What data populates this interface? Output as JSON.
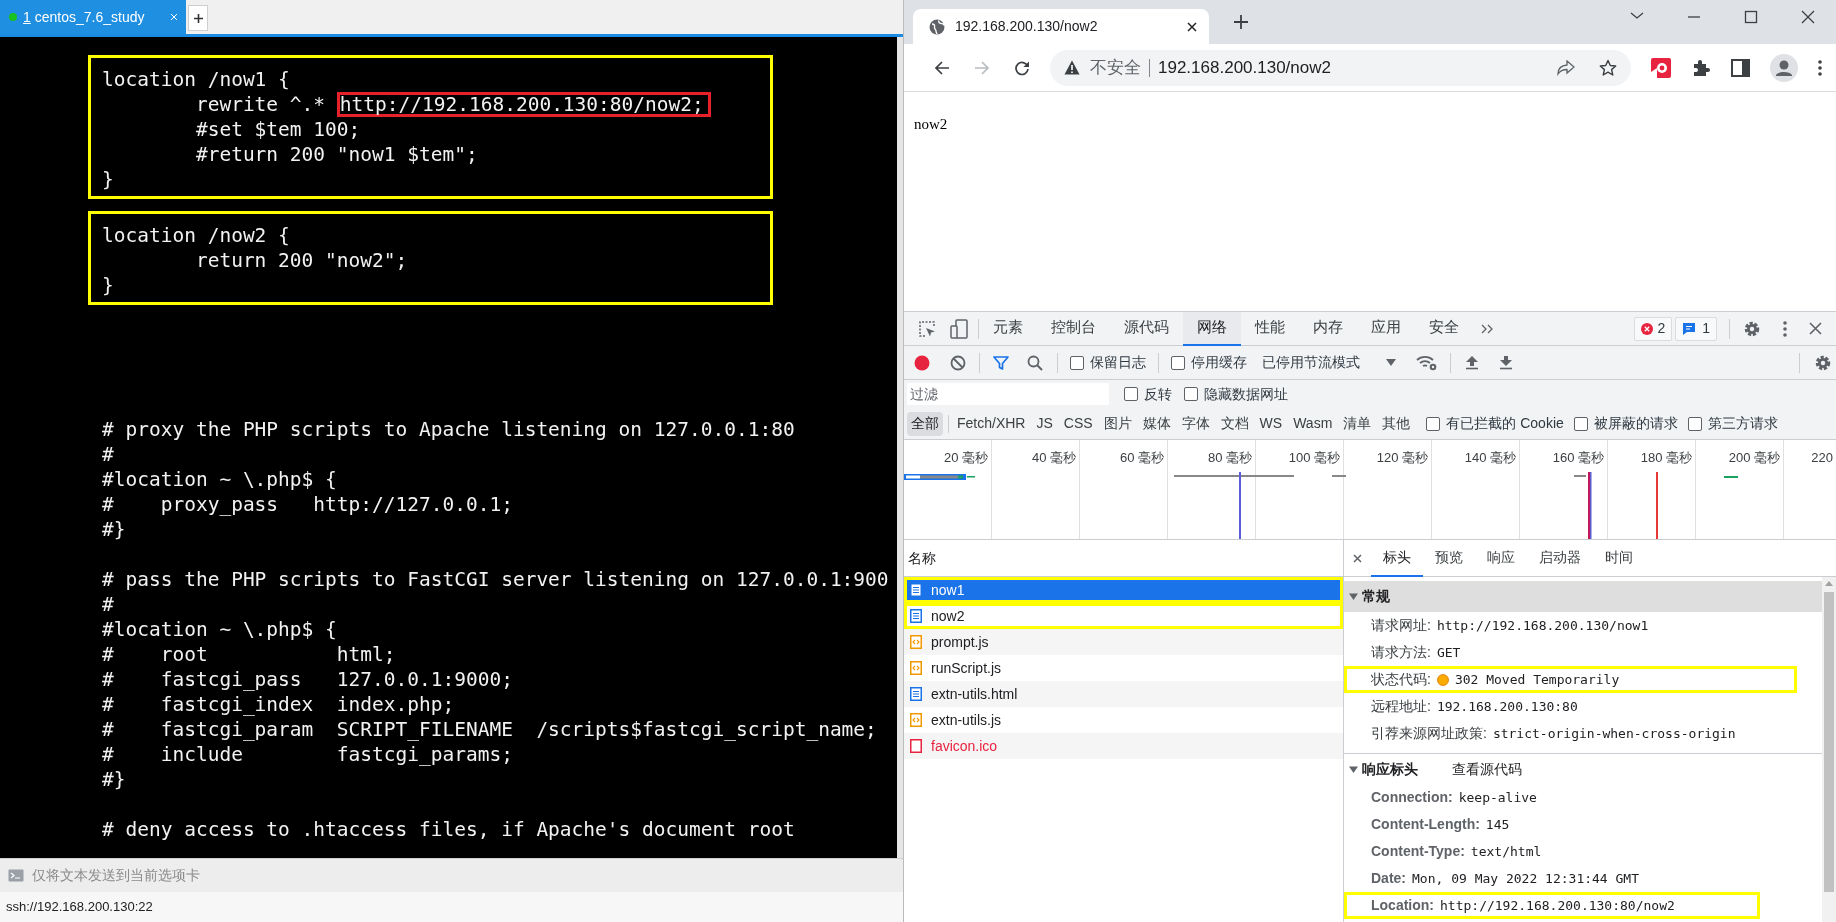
{
  "terminal": {
    "tabs": [
      {
        "number": "1",
        "label": "centos_7.6_study",
        "selected": true,
        "connected": true
      }
    ],
    "blocks": [
      {
        "annotated": true,
        "lines": [
          {
            "text": "location /now1 {"
          },
          {
            "text": "        rewrite ^.* ",
            "marked": "http://192.168.200.130:80/now2;"
          },
          {
            "text": "        #set $tem 100;"
          },
          {
            "text": "        #return 200 \"now1 $tem\";"
          },
          {
            "text": "}"
          }
        ]
      },
      {
        "annotated": true,
        "lines": [
          {
            "text": "location /now2 {"
          },
          {
            "text": "        return 200 \"now2\";"
          },
          {
            "text": "}"
          }
        ]
      },
      {
        "annotated": false,
        "lines": [
          {
            "text": "# proxy the PHP scripts to Apache listening on 127.0.0.1:80"
          },
          {
            "text": "#"
          },
          {
            "text": "#location ~ \\.php$ {"
          },
          {
            "text": "#    proxy_pass   http://127.0.0.1;"
          },
          {
            "text": "#}"
          }
        ]
      },
      {
        "annotated": false,
        "lines": [
          {
            "text": "# pass the PHP scripts to FastCGI server listening on 127.0.0.1:900"
          },
          {
            "text": "#"
          },
          {
            "text": "#location ~ \\.php$ {"
          },
          {
            "text": "#    root           html;"
          },
          {
            "text": "#    fastcgi_pass   127.0.0.1:9000;"
          },
          {
            "text": "#    fastcgi_index  index.php;"
          },
          {
            "text": "#    fastcgi_param  SCRIPT_FILENAME  /scripts$fastcgi_script_name;"
          },
          {
            "text": "#    include        fastcgi_params;"
          },
          {
            "text": "#}"
          }
        ]
      },
      {
        "annotated": false,
        "lines": [
          {
            "text": "# deny access to .htaccess files, if Apache's document root"
          }
        ]
      }
    ],
    "send_bar": {
      "placeholder": "仅将文本发送到当前选项卡"
    },
    "status": "ssh://192.168.200.130:22"
  },
  "browser": {
    "tabs": [
      {
        "title": "192.168.200.130/now2",
        "selected": true
      }
    ],
    "navigation": {
      "back_enabled": true,
      "forward_enabled": false
    },
    "address": {
      "security_label": "不安全",
      "url": "192.168.200.130/now2"
    },
    "page": {
      "text": "now2"
    },
    "devtools": {
      "tabs": [
        {
          "label": "元素",
          "selected": false
        },
        {
          "label": "控制台",
          "selected": false
        },
        {
          "label": "源代码",
          "selected": false
        },
        {
          "label": "网络",
          "selected": true
        },
        {
          "label": "性能",
          "selected": false
        },
        {
          "label": "内存",
          "selected": false
        },
        {
          "label": "应用",
          "selected": false
        },
        {
          "label": "安全",
          "selected": false
        }
      ],
      "errors": "2",
      "messages": "1",
      "recording": true,
      "filter_enabled": true,
      "preserve_log": {
        "label": "保留日志",
        "checked": false
      },
      "disable_cache": {
        "label": "停用缓存",
        "checked": false
      },
      "throttling": "已停用节流模式",
      "filter": {
        "placeholder": "过滤"
      },
      "filter_checks": [
        {
          "label": "反转",
          "checked": false
        },
        {
          "label": "隐藏数据网址",
          "checked": false
        }
      ],
      "type_filters": [
        {
          "label": "全部",
          "selected": true
        },
        {
          "label": "Fetch/XHR",
          "selected": false
        },
        {
          "label": "JS",
          "selected": false
        },
        {
          "label": "CSS",
          "selected": false
        },
        {
          "label": "图片",
          "selected": false
        },
        {
          "label": "媒体",
          "selected": false
        },
        {
          "label": "字体",
          "selected": false
        },
        {
          "label": "文档",
          "selected": false
        },
        {
          "label": "WS",
          "selected": false
        },
        {
          "label": "Wasm",
          "selected": false
        },
        {
          "label": "清单",
          "selected": false
        },
        {
          "label": "其他",
          "selected": false
        }
      ],
      "type_checks": [
        {
          "label": "有已拦截的 Cookie",
          "checked": false
        },
        {
          "label": "被屏蔽的请求",
          "checked": false
        },
        {
          "label": "第三方请求",
          "checked": false
        }
      ],
      "timeline_labels": [
        "20 毫秒",
        "40 毫秒",
        "60 毫秒",
        "80 毫秒",
        "100 毫秒",
        "120 毫秒",
        "140 毫秒",
        "160 毫秒",
        "180 毫秒",
        "200 毫秒",
        "220"
      ],
      "requests": {
        "column": "名称",
        "rows": [
          {
            "name": "now1",
            "kind": "document",
            "selected": true,
            "failed": false,
            "annotated": true
          },
          {
            "name": "now2",
            "kind": "document",
            "selected": false,
            "failed": false,
            "annotated": true
          },
          {
            "name": "prompt.js",
            "kind": "script",
            "selected": false,
            "failed": false,
            "annotated": false
          },
          {
            "name": "runScript.js",
            "kind": "script",
            "selected": false,
            "failed": false,
            "annotated": false
          },
          {
            "name": "extn-utils.html",
            "kind": "document",
            "selected": false,
            "failed": false,
            "annotated": false
          },
          {
            "name": "extn-utils.js",
            "kind": "script",
            "selected": false,
            "failed": false,
            "annotated": false
          },
          {
            "name": "favicon.ico",
            "kind": "other",
            "selected": false,
            "failed": true,
            "annotated": false
          }
        ]
      },
      "detail": {
        "tabs": [
          {
            "label": "标头",
            "selected": true
          },
          {
            "label": "预览",
            "selected": false
          },
          {
            "label": "响应",
            "selected": false
          },
          {
            "label": "启动器",
            "selected": false
          },
          {
            "label": "时间",
            "selected": false
          }
        ],
        "sections": [
          {
            "kind": "general",
            "title": "常规",
            "expanded": true,
            "rows": [
              {
                "kind": "plain",
                "key": "请求网址:",
                "value": "http://192.168.200.130/now1",
                "annotated": false
              },
              {
                "kind": "plain",
                "key": "请求方法:",
                "value": "GET",
                "annotated": false
              },
              {
                "kind": "status",
                "key": "状态代码:",
                "value": "302 Moved Temporarily",
                "annotated": true
              },
              {
                "kind": "plain",
                "key": "远程地址:",
                "value": "192.168.200.130:80",
                "annotated": false
              },
              {
                "kind": "plain",
                "key": "引荐来源网址政策:",
                "value": "strict-origin-when-cross-origin",
                "annotated": false
              }
            ]
          },
          {
            "kind": "response",
            "title": "响应标头",
            "link": "查看源代码",
            "expanded": true,
            "rows": [
              {
                "kind": "plain",
                "key": "Connection:",
                "value": "keep-alive",
                "annotated": false
              },
              {
                "kind": "plain",
                "key": "Content-Length:",
                "value": "145",
                "annotated": false
              },
              {
                "kind": "plain",
                "key": "Content-Type:",
                "value": "text/html",
                "annotated": false
              },
              {
                "kind": "plain",
                "key": "Date:",
                "value": "Mon, 09 May 2022 12:31:44 GMT",
                "annotated": false
              },
              {
                "kind": "plain",
                "key": "Location:",
                "value": "http://192.168.200.130:80/now2",
                "annotated": true
              }
            ]
          }
        ]
      }
    }
  }
}
